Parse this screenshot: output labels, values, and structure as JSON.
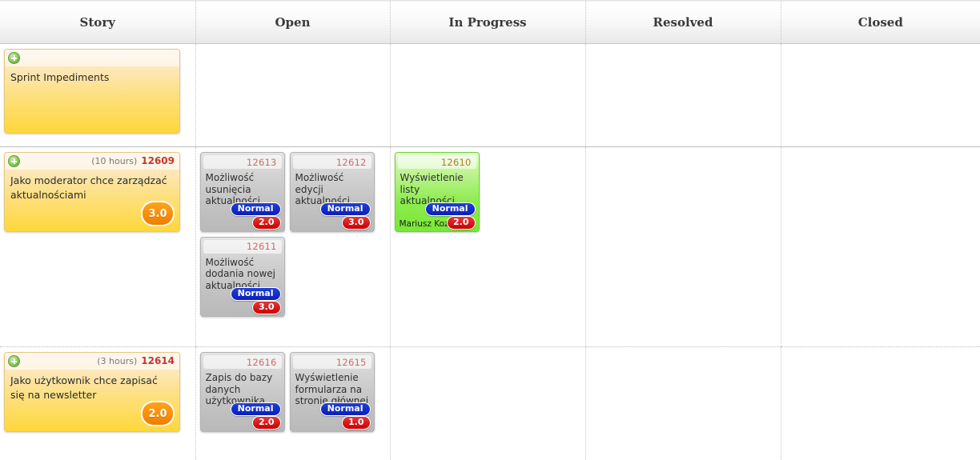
{
  "board": {
    "columns": [
      {
        "key": "story",
        "label": "Story"
      },
      {
        "key": "open",
        "label": "Open"
      },
      {
        "key": "in_progress",
        "label": "In Progress"
      },
      {
        "key": "resolved",
        "label": "Resolved"
      },
      {
        "key": "closed",
        "label": "Closed"
      }
    ],
    "colors": {
      "story_card_top": "#fdeee3",
      "story_card_bottom": "#ffd73a",
      "task_card_top": "#e3e3e3",
      "task_card_bottom": "#b9b9b9",
      "progress_card_top": "#e8fbd9",
      "progress_card_bottom": "#79e835",
      "id_red": "#c0392b",
      "badge_blue": "#0b1fb8",
      "badge_red": "#cc0000",
      "points_orange": "#ef7d00",
      "plus_green": "#4f9c28"
    },
    "rows": [
      {
        "name": "sprint-impediments-row",
        "story": {
          "title": "Sprint Impediments",
          "hours": "",
          "id": "",
          "points": "",
          "icon": "plus-circle-icon"
        },
        "open": [],
        "in_progress": [],
        "resolved": [],
        "closed": []
      },
      {
        "name": "story-12609-row",
        "story": {
          "title": "Jako moderator chce zarządzać aktualnościami",
          "hours": "(10 hours)",
          "id": "12609",
          "points": "3.0",
          "icon": "plus-circle-icon"
        },
        "open": [
          {
            "id": "12613",
            "title": "Możliwość usunięcia aktualności",
            "priority": "Normal",
            "points": "2.0",
            "assignee": ""
          },
          {
            "id": "12612",
            "title": "Możliwość edycji aktualności",
            "priority": "Normal",
            "points": "3.0",
            "assignee": ""
          },
          {
            "id": "12611",
            "title": "Możliwość dodania nowej aktualności",
            "priority": "Normal",
            "points": "3.0",
            "assignee": ""
          }
        ],
        "in_progress": [
          {
            "id": "12610",
            "title": "Wyświetlenie listy aktualności",
            "priority": "Normal",
            "points": "2.0",
            "assignee": "Mariusz Kozłow"
          }
        ],
        "resolved": [],
        "closed": []
      },
      {
        "name": "story-12614-row",
        "story": {
          "title": "Jako użytkownik chce zapisać się na newsletter",
          "hours": "(3 hours)",
          "id": "12614",
          "points": "2.0",
          "icon": "plus-circle-icon"
        },
        "open": [
          {
            "id": "12616",
            "title": "Zapis do bazy danych użytkownika",
            "priority": "Normal",
            "points": "2.0",
            "assignee": ""
          },
          {
            "id": "12615",
            "title": "Wyświetlenie formularza na stronie głównej",
            "priority": "Normal",
            "points": "1.0",
            "assignee": ""
          }
        ],
        "in_progress": [],
        "resolved": [],
        "closed": []
      }
    ]
  }
}
